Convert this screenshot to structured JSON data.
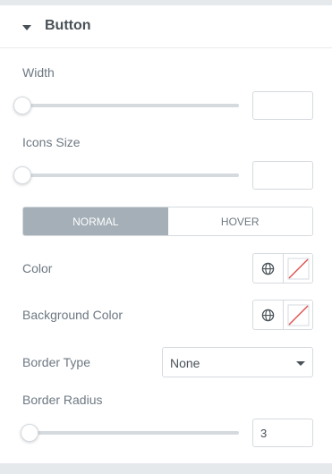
{
  "section": {
    "title": "Button",
    "icon": "caret-down-icon"
  },
  "width_control": {
    "label": "Width",
    "value": "",
    "slider_position": 0
  },
  "icons_size_control": {
    "label": "Icons Size",
    "value": "",
    "slider_position": 0
  },
  "state_tabs": {
    "normal": "NORMAL",
    "hover": "HOVER",
    "active": "normal"
  },
  "color_control": {
    "label": "Color",
    "globe_icon": "globe-icon",
    "swatch": "empty"
  },
  "background_color_control": {
    "label": "Background Color",
    "globe_icon": "globe-icon",
    "swatch": "empty"
  },
  "border_type_control": {
    "label": "Border Type",
    "selected": "None"
  },
  "border_radius_control": {
    "label": "Border Radius",
    "value": "3",
    "slider_position": 0.03
  },
  "colors": {
    "tab_active_bg": "#a4afb7",
    "label_text": "#6d7882",
    "title_text": "#495157",
    "empty_swatch_slash": "#e04b4b",
    "border": "#d5dadf"
  }
}
